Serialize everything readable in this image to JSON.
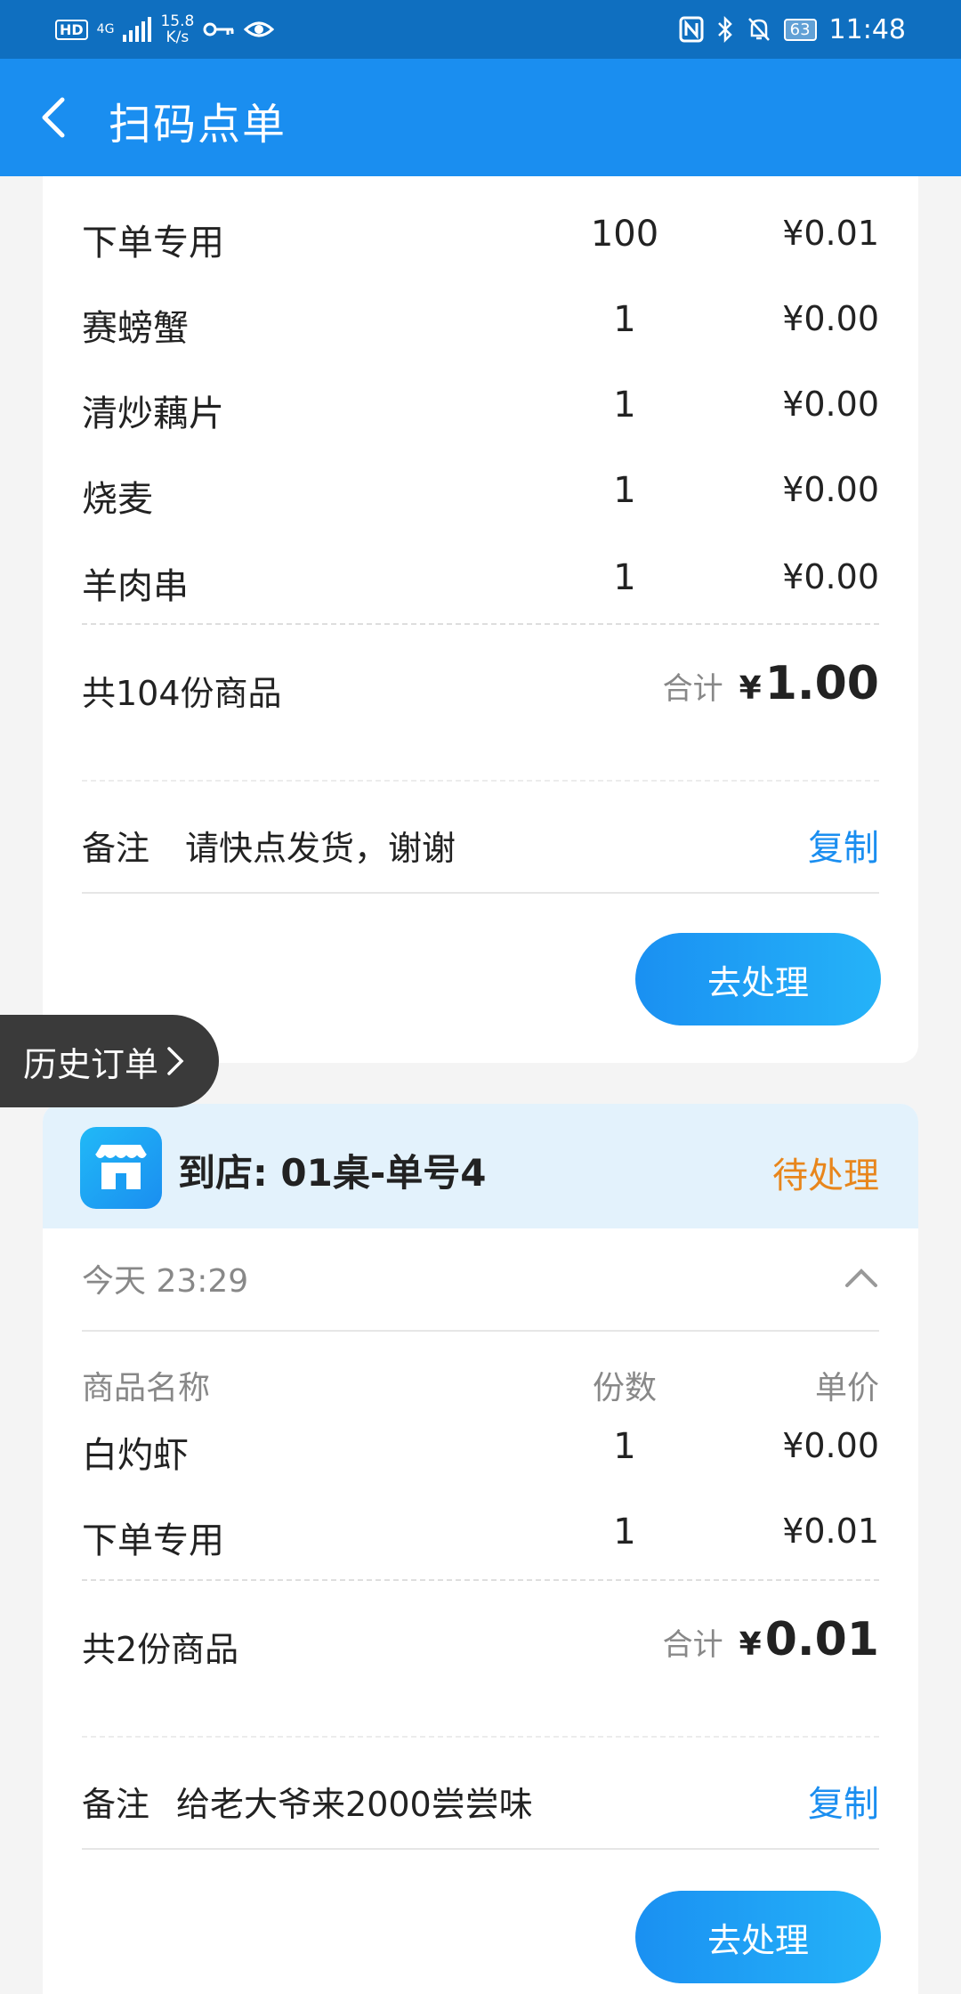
{
  "status_bar": {
    "left": {
      "hd": "HD",
      "signal": "4G",
      "speed_value": "15.8",
      "speed_unit": "K/s"
    },
    "battery": "63",
    "time": "11:48"
  },
  "header": {
    "title": "扫码点单"
  },
  "order1": {
    "items": [
      {
        "name": "下单专用",
        "qty": "100",
        "price": "¥0.01"
      },
      {
        "name": "赛螃蟹",
        "qty": "1",
        "price": "¥0.00"
      },
      {
        "name": "清炒藕片",
        "qty": "1",
        "price": "¥0.00"
      },
      {
        "name": "烧麦",
        "qty": "1",
        "price": "¥0.00"
      },
      {
        "name": "羊肉串",
        "qty": "1",
        "price": "¥0.00"
      }
    ],
    "count_text": "共104份商品",
    "total_label": "合计",
    "currency": "¥",
    "total_amount": "1.00",
    "remark_label": "备注",
    "remark_text": "请快点发货，谢谢",
    "copy_label": "复制",
    "action_label": "去处理"
  },
  "history_tab": {
    "label": "历史订单"
  },
  "order2": {
    "title": "到店: 01桌-单号4",
    "status": "待处理",
    "time": "今天 23:29",
    "columns": {
      "name": "商品名称",
      "qty": "份数",
      "price": "单价"
    },
    "items": [
      {
        "name": "白灼虾",
        "qty": "1",
        "price": "¥0.00"
      },
      {
        "name": "下单专用",
        "qty": "1",
        "price": "¥0.01"
      }
    ],
    "count_text": "共2份商品",
    "total_label": "合计",
    "currency": "¥",
    "total_amount": "0.01",
    "remark_label": "备注",
    "remark_text": "给老大爷来2000尝尝味",
    "copy_label": "复制",
    "action_label": "去处理"
  }
}
